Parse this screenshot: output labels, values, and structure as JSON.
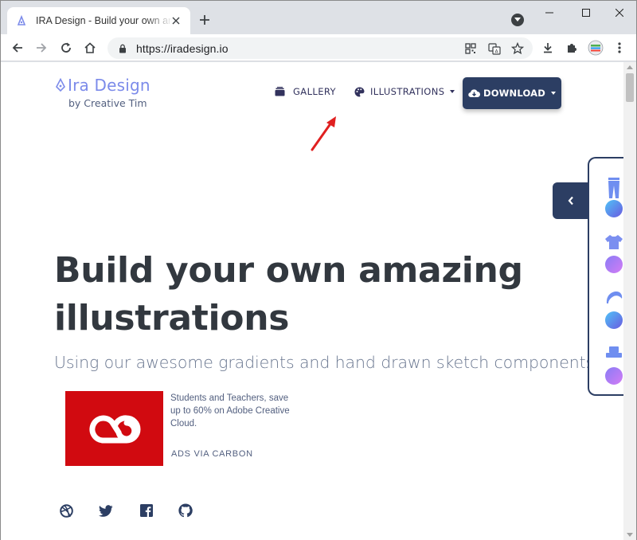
{
  "browser": {
    "tab_title": "IRA Design - Build your own amazing illustrations",
    "url": "https://iradesign.io"
  },
  "nav": {
    "brand": "Ira Design",
    "brand_sub": "by Creative Tim",
    "gallery": "GALLERY",
    "illustrations": "ILLUSTRATIONS",
    "download": "DOWNLOAD"
  },
  "hero": {
    "title": "Build your own amazing illustrations",
    "subtitle": "Using our awesome gradients and hand drawn sketch components."
  },
  "ad": {
    "text": "Students and Teachers, save up to 60% on Adobe Creative Cloud.",
    "via": "ADS VIA CARBON"
  },
  "social": [
    "dribbble-icon",
    "twitter-icon",
    "facebook-icon",
    "github-icon"
  ],
  "colors": {
    "brand": "#7c8bea",
    "navy": "#2c3e63",
    "ad_red": "#d10a10",
    "gradient_blue": "#42a5f5",
    "gradient_purple": "#c084fc"
  }
}
